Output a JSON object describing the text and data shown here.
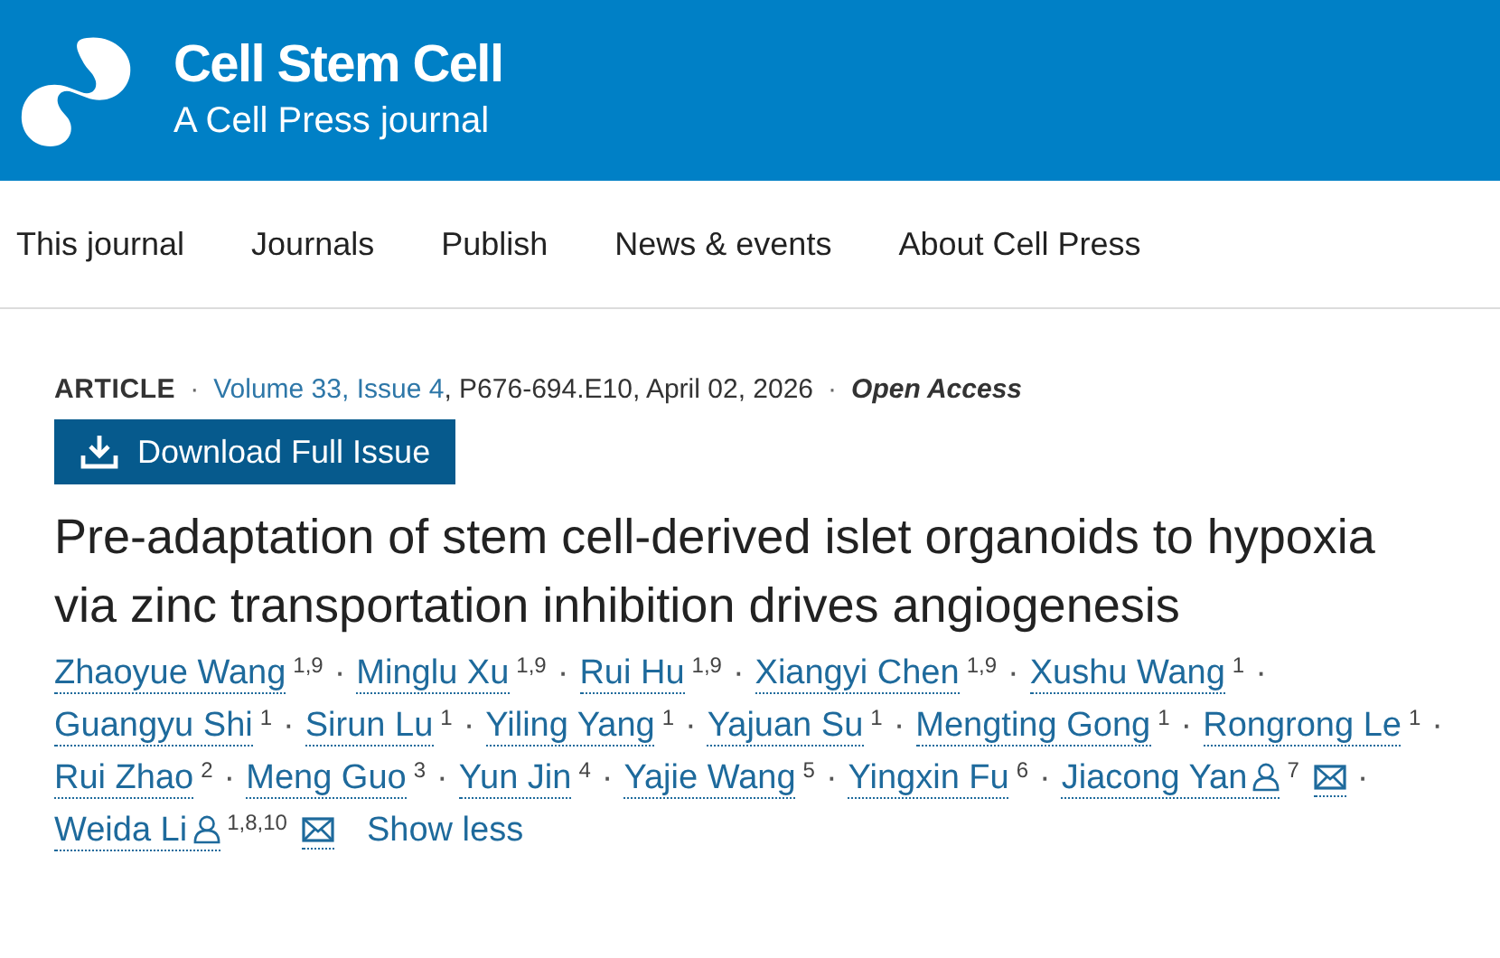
{
  "header": {
    "journal": "Cell Stem Cell",
    "tagline": "A Cell Press journal"
  },
  "nav": [
    "This journal",
    "Journals",
    "Publish",
    "News & events",
    "About Cell Press"
  ],
  "meta": {
    "type": "ARTICLE",
    "sep1": "·",
    "issue_link": "Volume 33, Issue 4",
    "details": ", P676-694.E10, April 02, 2026",
    "sep2": "·",
    "access": "Open Access"
  },
  "download_button": "Download Full Issue",
  "title": "Pre-adaptation of stem cell-derived islet organoids to hypoxia via zinc transportation inhibition drives angiogenesis",
  "author_lines": [
    [
      {
        "name": "Zhaoyue Wang",
        "corresponding": false,
        "affiliations": "1,9",
        "email": false,
        "separator": "·"
      },
      {
        "name": "Minglu Xu",
        "corresponding": false,
        "affiliations": "1,9",
        "email": false,
        "separator": "·"
      },
      {
        "name": "Rui Hu",
        "corresponding": false,
        "affiliations": "1,9",
        "email": false,
        "separator": "·"
      },
      {
        "name": "Xiangyi Chen",
        "corresponding": false,
        "affiliations": "1,9",
        "email": false,
        "separator": "·"
      },
      {
        "name": "Xushu Wang",
        "corresponding": false,
        "affiliations": "1",
        "email": false,
        "separator": "·"
      }
    ],
    [
      {
        "name": "Guangyu Shi",
        "corresponding": false,
        "affiliations": "1",
        "email": false,
        "separator": "·"
      },
      {
        "name": "Sirun Lu",
        "corresponding": false,
        "affiliations": "1",
        "email": false,
        "separator": "·"
      },
      {
        "name": "Yiling Yang",
        "corresponding": false,
        "affiliations": "1",
        "email": false,
        "separator": "·"
      },
      {
        "name": "Yajuan Su",
        "corresponding": false,
        "affiliations": "1",
        "email": false,
        "separator": "·"
      },
      {
        "name": "Mengting Gong",
        "corresponding": false,
        "affiliations": "1",
        "email": false,
        "separator": "·"
      },
      {
        "name": "Rongrong Le",
        "corresponding": false,
        "affiliations": "1",
        "email": false,
        "separator": "·"
      }
    ],
    [
      {
        "name": "Rui Zhao",
        "corresponding": false,
        "affiliations": "2",
        "email": false,
        "separator": "·"
      },
      {
        "name": "Meng Guo",
        "corresponding": false,
        "affiliations": "3",
        "email": false,
        "separator": "·"
      },
      {
        "name": "Yun Jin",
        "corresponding": false,
        "affiliations": "4",
        "email": false,
        "separator": "·"
      },
      {
        "name": "Yajie Wang",
        "corresponding": false,
        "affiliations": "5",
        "email": false,
        "separator": "·"
      },
      {
        "name": "Yingxin Fu",
        "corresponding": false,
        "affiliations": "6",
        "email": false,
        "separator": "·"
      },
      {
        "name": "Jiacong Yan",
        "corresponding": true,
        "affiliations": "7",
        "email": true,
        "separator": "·"
      }
    ],
    [
      {
        "name": "Weida Li",
        "corresponding": true,
        "affiliations": "1,8,10",
        "email": true
      }
    ]
  ],
  "show_less": "Show less"
}
